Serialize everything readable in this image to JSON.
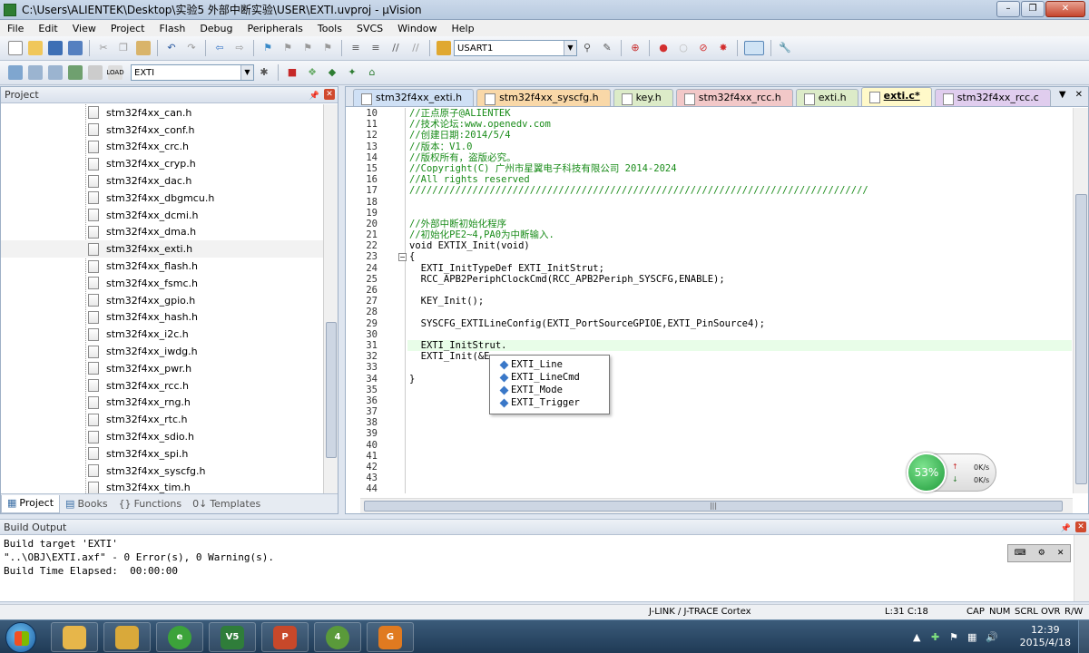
{
  "window": {
    "title": "C:\\Users\\ALIENTEK\\Desktop\\实验5 外部中断实验\\USER\\EXTI.uvproj - µVision"
  },
  "menu": [
    "File",
    "Edit",
    "View",
    "Project",
    "Flash",
    "Debug",
    "Peripherals",
    "Tools",
    "SVCS",
    "Window",
    "Help"
  ],
  "toolbar": {
    "find_combo": "USART1",
    "target_combo": "EXTI"
  },
  "project_panel": {
    "title": "Project",
    "files": [
      "stm32f4xx_can.h",
      "stm32f4xx_conf.h",
      "stm32f4xx_crc.h",
      "stm32f4xx_cryp.h",
      "stm32f4xx_dac.h",
      "stm32f4xx_dbgmcu.h",
      "stm32f4xx_dcmi.h",
      "stm32f4xx_dma.h",
      "stm32f4xx_exti.h",
      "stm32f4xx_flash.h",
      "stm32f4xx_fsmc.h",
      "stm32f4xx_gpio.h",
      "stm32f4xx_hash.h",
      "stm32f4xx_i2c.h",
      "stm32f4xx_iwdg.h",
      "stm32f4xx_pwr.h",
      "stm32f4xx_rcc.h",
      "stm32f4xx_rng.h",
      "stm32f4xx_rtc.h",
      "stm32f4xx_sdio.h",
      "stm32f4xx_spi.h",
      "stm32f4xx_syscfg.h",
      "stm32f4xx_tim.h"
    ],
    "selected_index": 8,
    "tabs": [
      "Project",
      "Books",
      "Functions",
      "Templates"
    ]
  },
  "editor": {
    "tabs": [
      {
        "label": "stm32f4xx_exti.h",
        "color": "#cfe0f5"
      },
      {
        "label": "stm32f4xx_syscfg.h",
        "color": "#f9d8a8"
      },
      {
        "label": "key.h",
        "color": "#dcebc8"
      },
      {
        "label": "stm32f4xx_rcc.h",
        "color": "#f2c8c8"
      },
      {
        "label": "exti.h",
        "color": "#dcebc8"
      },
      {
        "label": "exti.c*",
        "color": "#fff9c9"
      },
      {
        "label": "stm32f4xx_rcc.c",
        "color": "#e0cdee"
      }
    ],
    "active_tab": 5,
    "lines": [
      {
        "n": "10",
        "t": "//正点原子@ALIENTEK",
        "c": true
      },
      {
        "n": "11",
        "t": "//技术论坛:www.openedv.com",
        "c": true
      },
      {
        "n": "12",
        "t": "//创建日期:2014/5/4",
        "c": true
      },
      {
        "n": "13",
        "t": "//版本：V1.0",
        "c": true
      },
      {
        "n": "14",
        "t": "//版权所有，盗版必究。",
        "c": true
      },
      {
        "n": "15",
        "t": "//Copyright(C) 广州市星翼电子科技有限公司 2014-2024",
        "c": true
      },
      {
        "n": "16",
        "t": "//All rights reserved",
        "c": true
      },
      {
        "n": "17",
        "t": "////////////////////////////////////////////////////////////////////////////////",
        "c": true
      },
      {
        "n": "18",
        "t": "",
        "c": false
      },
      {
        "n": "19",
        "t": "",
        "c": false
      },
      {
        "n": "20",
        "t": "//外部中断初始化程序",
        "c": true
      },
      {
        "n": "21",
        "t": "//初始化PE2~4,PA0为中断输入.",
        "c": true
      },
      {
        "n": "22",
        "t": "void EXTIX_Init(void)",
        "c": false
      },
      {
        "n": "23",
        "t": "{",
        "c": false
      },
      {
        "n": "24",
        "t": "  EXTI_InitTypeDef EXTI_InitStrut;",
        "c": false
      },
      {
        "n": "25",
        "t": "  RCC_APB2PeriphClockCmd(RCC_APB2Periph_SYSCFG,ENABLE);",
        "c": false
      },
      {
        "n": "26",
        "t": "",
        "c": false
      },
      {
        "n": "27",
        "t": "  KEY_Init();",
        "c": false
      },
      {
        "n": "28",
        "t": "",
        "c": false
      },
      {
        "n": "29",
        "t": "  SYSCFG_EXTILineConfig(EXTI_PortSourceGPIOE,EXTI_PinSource4);",
        "c": false
      },
      {
        "n": "30",
        "t": "",
        "c": false
      },
      {
        "n": "31",
        "t": "  EXTI_InitStrut.",
        "c": false
      },
      {
        "n": "32",
        "t": "  EXTI_Init(&E",
        "c": false
      },
      {
        "n": "33",
        "t": "",
        "c": false
      },
      {
        "n": "34",
        "t": "}",
        "c": false
      },
      {
        "n": "35",
        "t": "",
        "c": false
      },
      {
        "n": "36",
        "t": "",
        "c": false
      },
      {
        "n": "37",
        "t": "",
        "c": false
      },
      {
        "n": "38",
        "t": "",
        "c": false
      },
      {
        "n": "39",
        "t": "",
        "c": false
      },
      {
        "n": "40",
        "t": "",
        "c": false
      },
      {
        "n": "41",
        "t": "",
        "c": false
      },
      {
        "n": "42",
        "t": "",
        "c": false
      },
      {
        "n": "43",
        "t": "",
        "c": false
      },
      {
        "n": "44",
        "t": "",
        "c": false
      }
    ],
    "current_line_index": 21,
    "autocomplete": [
      "EXTI_Line",
      "EXTI_LineCmd",
      "EXTI_Mode",
      "EXTI_Trigger"
    ]
  },
  "net_widget": {
    "percent": "53%",
    "up": "0K/s",
    "down": "0K/s"
  },
  "build_output": {
    "title": "Build Output",
    "lines": [
      "Build target 'EXTI'",
      "\"..\\OBJ\\EXTI.axf\" - 0 Error(s), 0 Warning(s).",
      "Build Time Elapsed:  00:00:00"
    ]
  },
  "status": {
    "debugger": "J-LINK / J-TRACE Cortex",
    "position": "L:31 C:18",
    "caps": "CAP",
    "num": "NUM",
    "scrl": "SCRL",
    "ovr": "OVR",
    "rw": "R/W"
  },
  "taskbar": {
    "apps": [
      {
        "name": "folder",
        "color": "#e7b64a"
      },
      {
        "name": "browser",
        "color": "#3ca33a"
      },
      {
        "name": "keil",
        "color": "#2f7d3a"
      },
      {
        "name": "powerpoint",
        "color": "#c8482a"
      },
      {
        "name": "app4",
        "color": "#5a9a3a"
      },
      {
        "name": "pdf",
        "color": "#e07a20"
      }
    ],
    "time": "12:39",
    "date": "2015/4/18"
  }
}
